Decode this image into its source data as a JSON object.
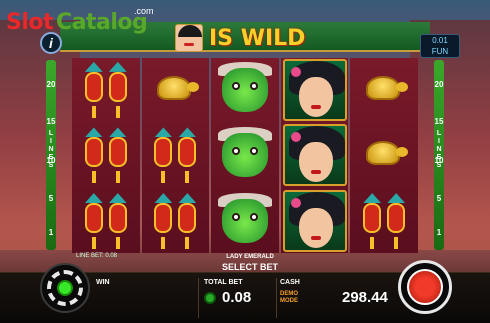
{
  "brand": {
    "slot": "Slot",
    "catalog": "Catalog",
    "com": ".com"
  },
  "header": {
    "title": "IS WILD",
    "info_symbol": "i"
  },
  "coin": {
    "value": "0.01",
    "mode": "FUN"
  },
  "lines": {
    "label": [
      "L",
      "I",
      "N",
      "E",
      "S"
    ],
    "numbers": [
      "20",
      "15",
      "10",
      "5",
      "1"
    ]
  },
  "reels": [
    [
      "lantern",
      "lantern",
      "lantern"
    ],
    [
      "turtle",
      "lantern",
      "lantern"
    ],
    [
      "dragon",
      "dragon",
      "dragon"
    ],
    [
      "lady",
      "lady",
      "lady"
    ],
    [
      "turtle",
      "turtle",
      "lantern"
    ]
  ],
  "footer": {
    "line_bet": "LINE BET: 0.08",
    "symbol_caption": "LADY EMERALD",
    "select_bet": "SELECT BET",
    "win_label": "WIN",
    "total_bet_label": "TOTAL BET",
    "total_bet_value": "0.08",
    "cash_label": "CASH",
    "demo_mode": "DEMO MODE",
    "cash_value": "298.44"
  },
  "colors": {
    "accent_gold": "#f7d02a",
    "reel_red": "#7a1a2a",
    "spin_red": "#f23a2a",
    "gear_green": "#3ae82a"
  }
}
